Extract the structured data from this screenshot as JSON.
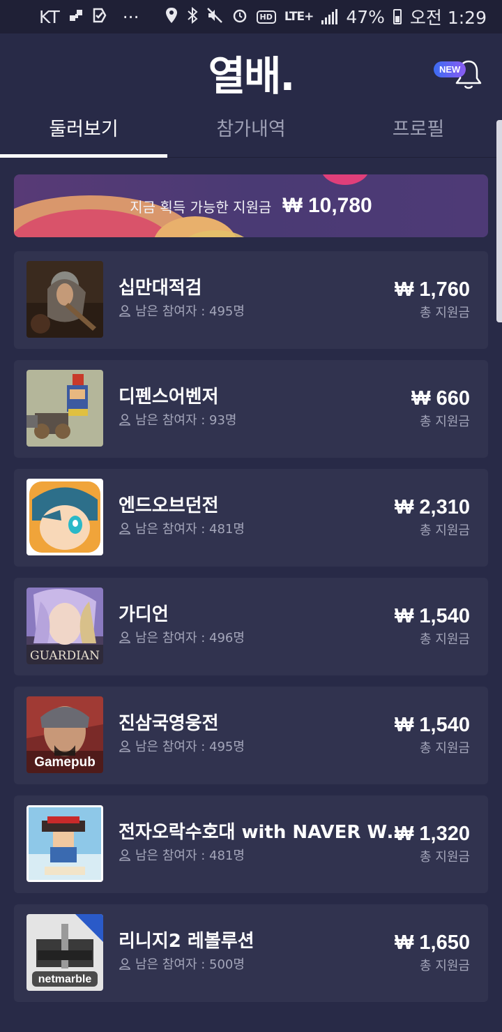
{
  "status_bar": {
    "carrier": "KT",
    "dots": "···",
    "hd": "HD",
    "lte": "LTE+",
    "battery": "47%",
    "time": "오전 1:29"
  },
  "header": {
    "logo": "열배.",
    "new_badge": "NEW"
  },
  "tabs": [
    {
      "label": "둘러보기",
      "active": true
    },
    {
      "label": "참가내역",
      "active": false
    },
    {
      "label": "프로필",
      "active": false
    }
  ],
  "banner": {
    "text": "지금 획득 가능한 지원금",
    "amount": "₩ 10,780"
  },
  "games": [
    {
      "title": "십만대적검",
      "participants": "남은 참여자 : 495명",
      "amount": "₩ 1,760",
      "amount_label": "총 지원금",
      "thumb_text": ""
    },
    {
      "title": "디펜스어벤저",
      "participants": "남은 참여자 : 93명",
      "amount": "₩ 660",
      "amount_label": "총 지원금",
      "thumb_text": ""
    },
    {
      "title": "엔드오브던전",
      "participants": "남은 참여자 : 481명",
      "amount": "₩ 2,310",
      "amount_label": "총 지원금",
      "thumb_text": ""
    },
    {
      "title": "가디언",
      "participants": "남은 참여자 : 496명",
      "amount": "₩ 1,540",
      "amount_label": "총 지원금",
      "thumb_text": "GUARDIAN"
    },
    {
      "title": "진삼국영웅전",
      "participants": "남은 참여자 : 495명",
      "amount": "₩ 1,540",
      "amount_label": "총 지원금",
      "thumb_text": "Gamepub"
    },
    {
      "title": "전자오락수호대 with NAVER WEBTOON",
      "participants": "남은 참여자 : 481명",
      "amount": "₩ 1,320",
      "amount_label": "총 지원금",
      "thumb_text": ""
    },
    {
      "title": "리니지2 레볼루션",
      "participants": "남은 참여자 : 500명",
      "amount": "₩ 1,650",
      "amount_label": "총 지원금",
      "thumb_text": "netmarble"
    }
  ],
  "colors": {
    "background": "#282a47",
    "card": "#31334f",
    "status_bar": "#1f2036",
    "accent_badge": "#5a66f2"
  }
}
